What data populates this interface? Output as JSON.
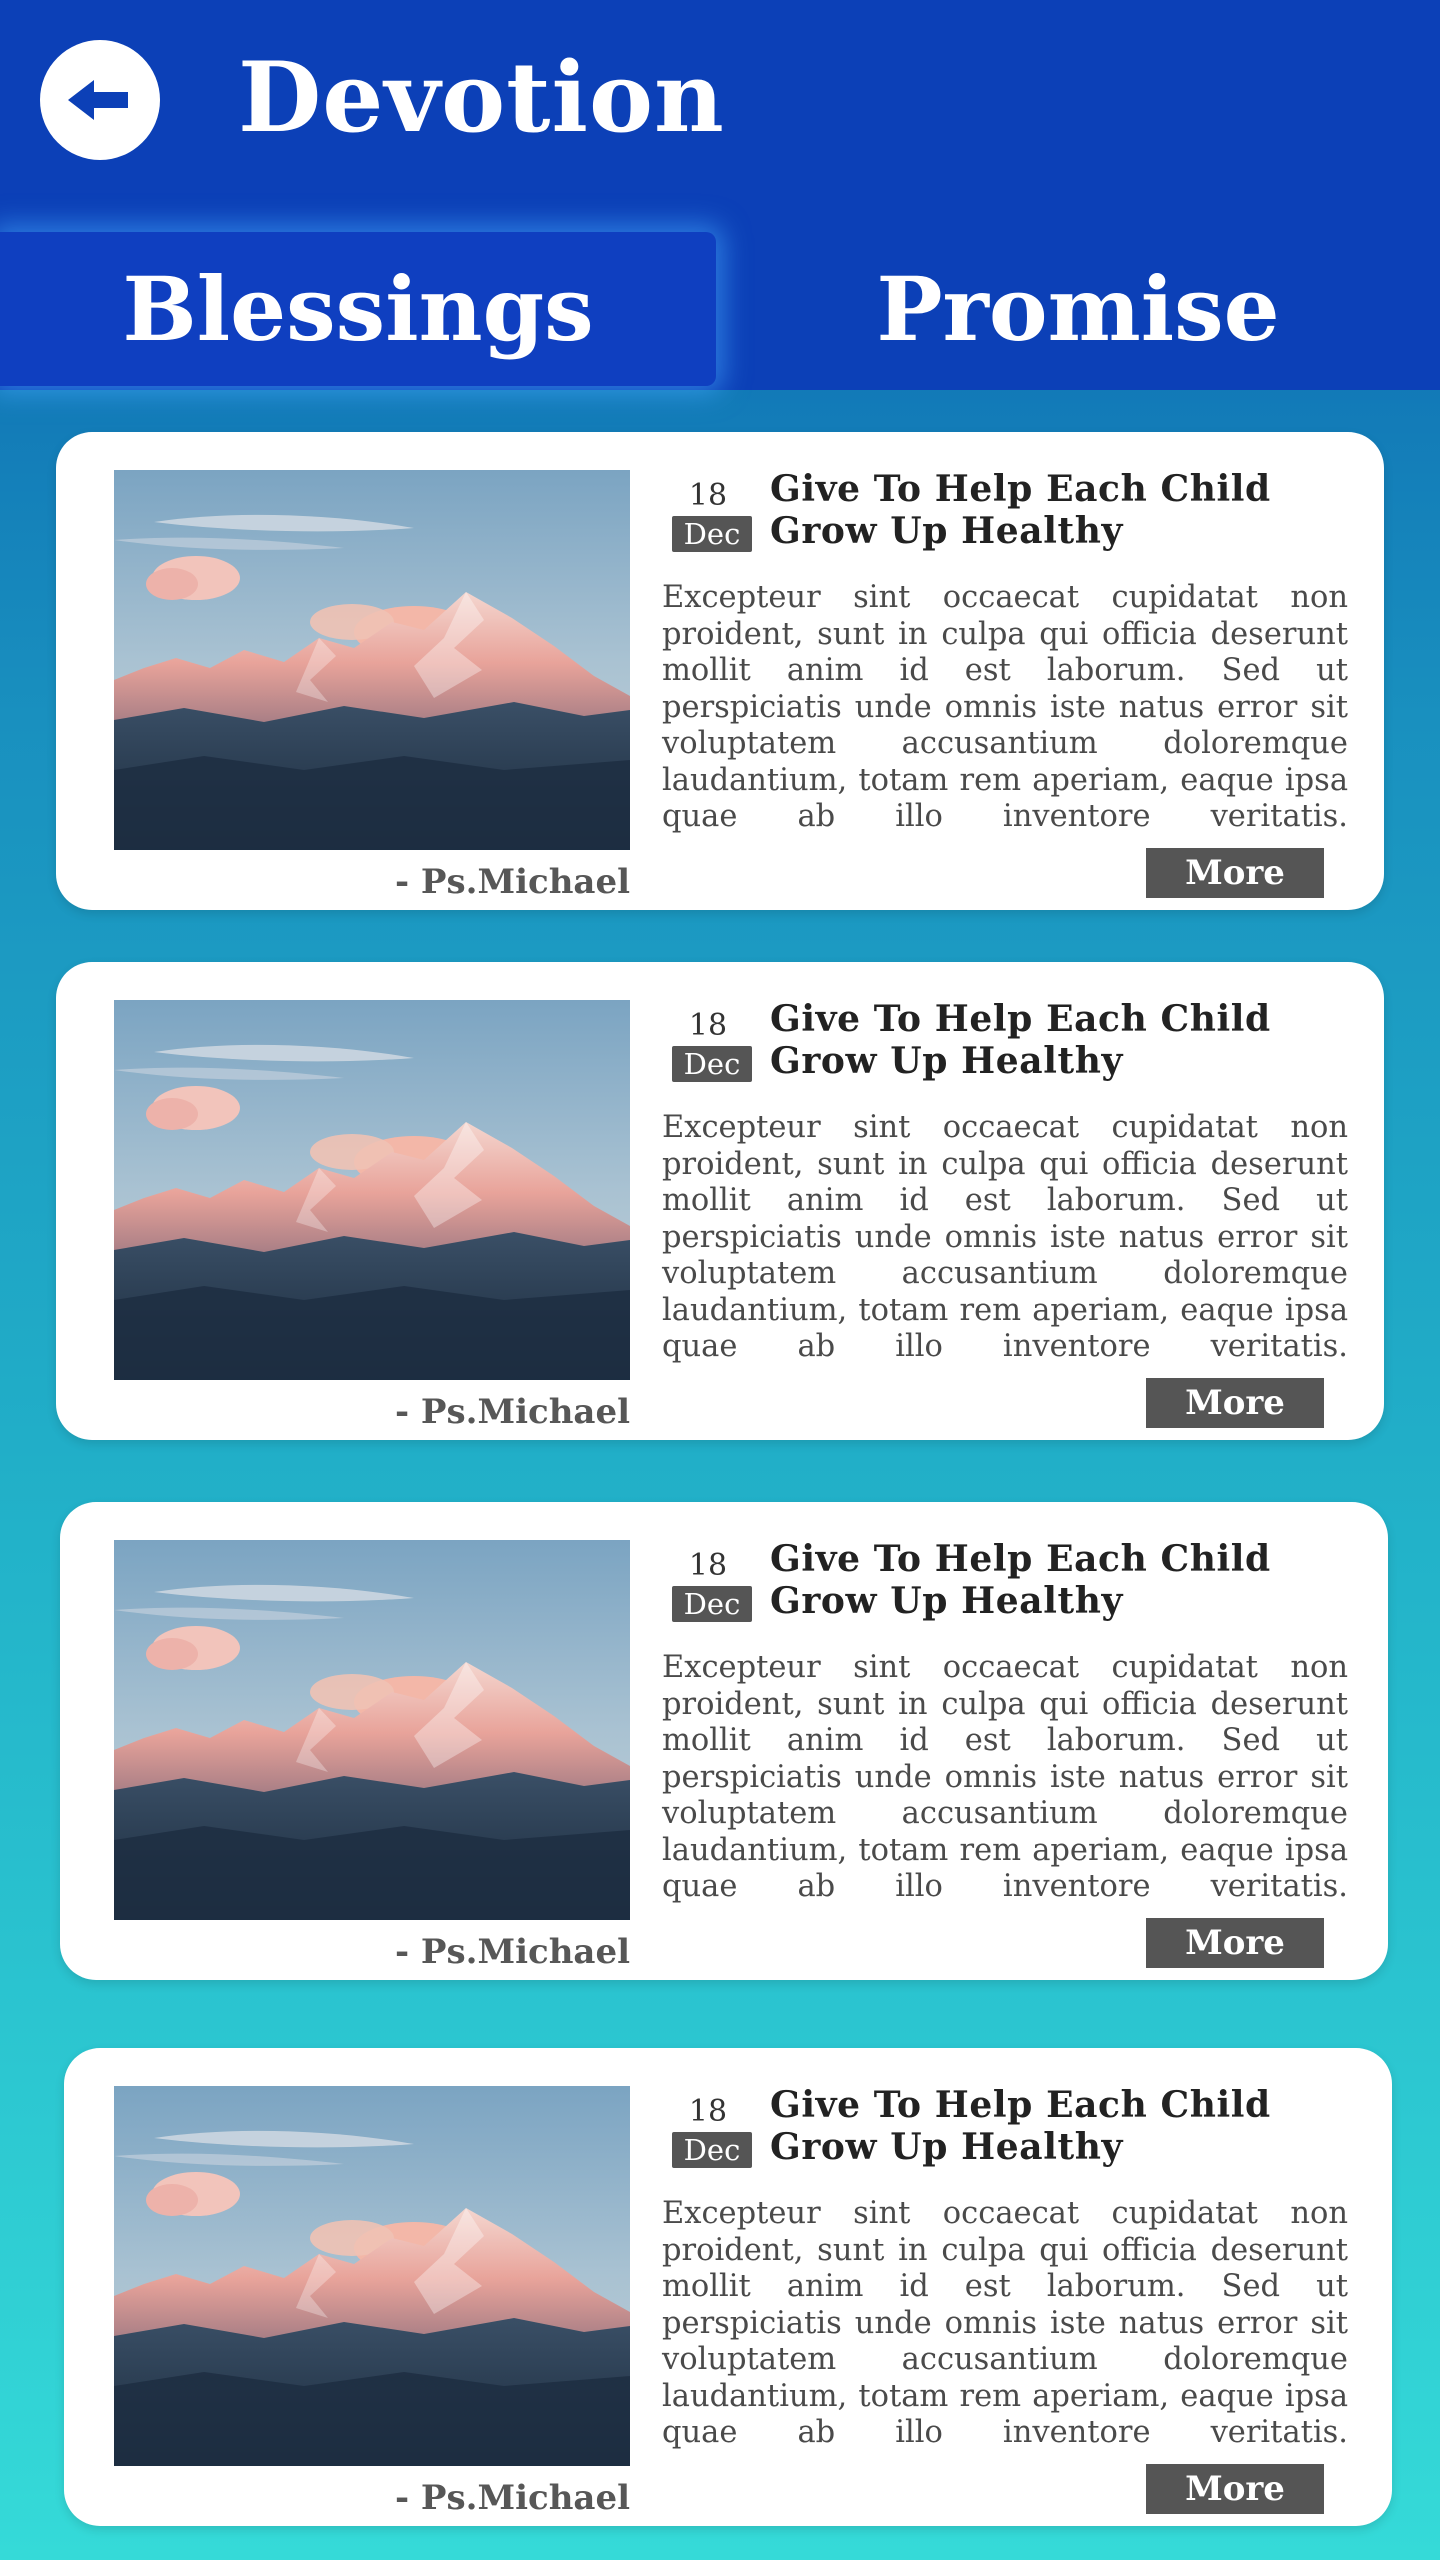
{
  "header": {
    "title": "Devotion",
    "back_icon": "arrow-left-icon",
    "background": "#0c40b7"
  },
  "tabs": [
    {
      "label": "Blessings",
      "active": true
    },
    {
      "label": "Promise",
      "active": false
    }
  ],
  "cards": [
    {
      "image": "mountain-sunset-image",
      "author": "- Ps.Michael",
      "date_day": "18",
      "date_month": "Dec",
      "title": "Give To Help Each Child Grow Up Healthy",
      "body": "Excepteur sint occaecat cupidatat non proident, sunt in culpa qui officia deserunt mollit anim id est laborum. Sed ut perspiciatis unde omnis iste natus error sit voluptatem accusantium doloremque laudantium, totam rem aperiam, eaque ipsa quae ab illo inventore veritatis.",
      "more_label": "More"
    },
    {
      "image": "mountain-sunset-image",
      "author": "- Ps.Michael",
      "date_day": "18",
      "date_month": "Dec",
      "title": "Give To Help Each Child Grow Up Healthy",
      "body": "Excepteur sint occaecat cupidatat non proident, sunt in culpa qui officia deserunt mollit anim id est laborum. Sed ut perspiciatis unde omnis iste natus error sit voluptatem accusantium doloremque laudantium, totam rem aperiam, eaque ipsa quae ab illo inventore veritatis.",
      "more_label": "More"
    },
    {
      "image": "mountain-sunset-image",
      "author": "- Ps.Michael",
      "date_day": "18",
      "date_month": "Dec",
      "title": "Give To Help Each Child Grow Up Healthy",
      "body": "Excepteur sint occaecat cupidatat non proident, sunt in culpa qui officia deserunt mollit anim id est laborum. Sed ut perspiciatis unde omnis iste natus error sit voluptatem accusantium doloremque laudantium, totam rem aperiam, eaque ipsa quae ab illo inventore veritatis.",
      "more_label": "More"
    },
    {
      "image": "mountain-sunset-image",
      "author": "- Ps.Michael",
      "date_day": "18",
      "date_month": "Dec",
      "title": "Give To Help Each Child Grow Up Healthy",
      "body": "Excepteur sint occaecat cupidatat non proident, sunt in culpa qui officia deserunt mollit anim id est laborum. Sed ut perspiciatis unde omnis iste natus error sit voluptatem accusantium doloremque laudantium, totam rem aperiam, eaque ipsa quae ab illo inventore veritatis.",
      "more_label": "More"
    }
  ]
}
